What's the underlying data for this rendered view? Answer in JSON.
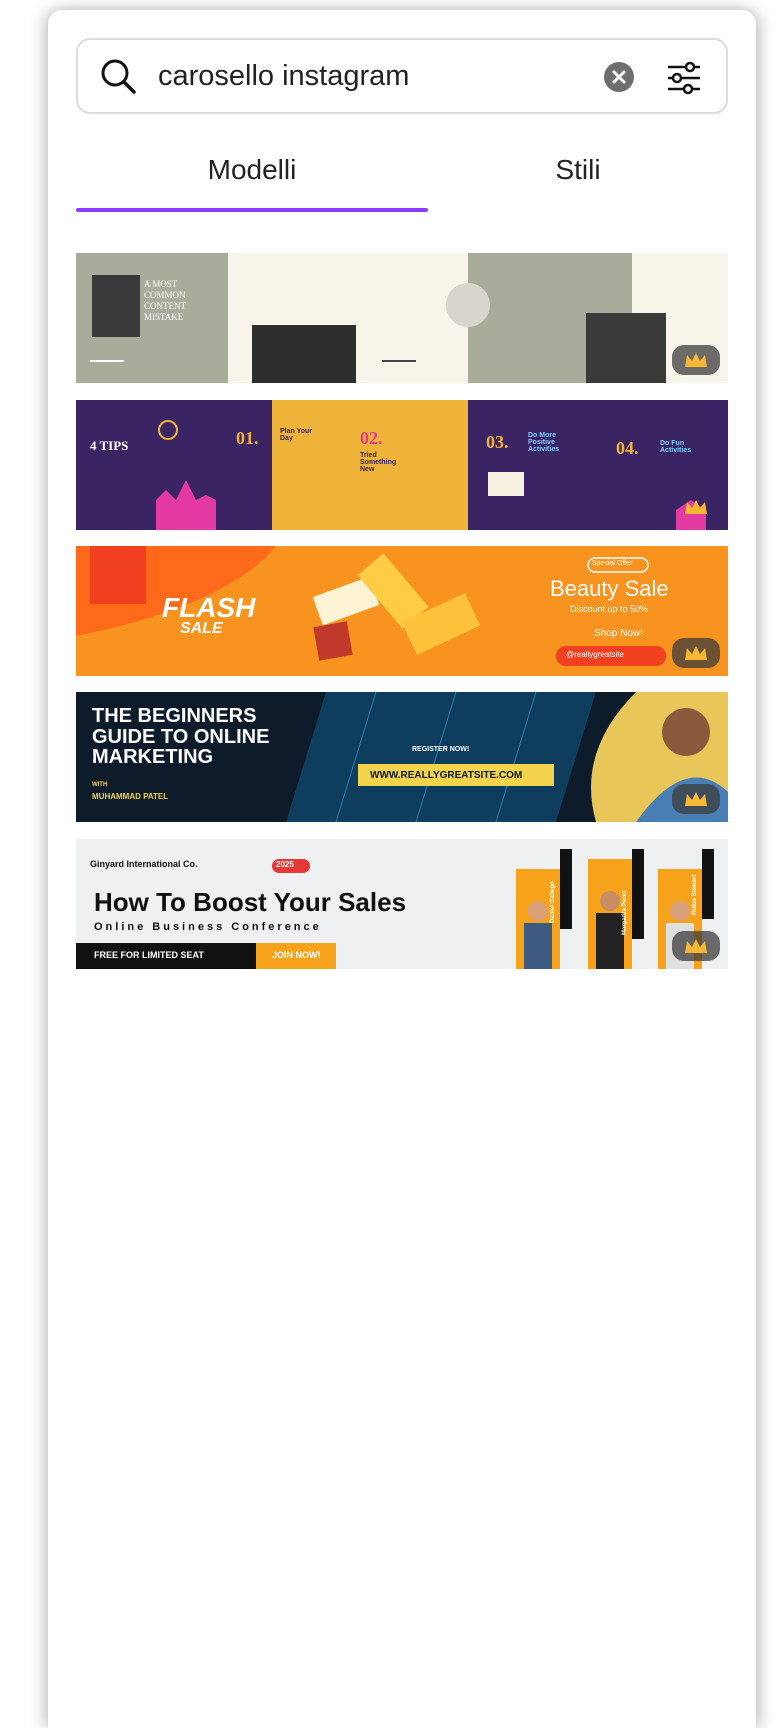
{
  "search": {
    "value": "carosello instagram",
    "placeholder": ""
  },
  "tabs": [
    {
      "label": "Modelli"
    },
    {
      "label": "Stili"
    }
  ],
  "templates": [
    {
      "lines": [
        "A MOST",
        "COMMON",
        "CONTENT",
        "MISTAKE"
      ]
    },
    {
      "title": "4 TIPS",
      "n1": "01.",
      "h1": "Plan Your Day",
      "n2": "02.",
      "h2": "Tried Something New",
      "n3": "03.",
      "h3": "Do More Positive Activities",
      "n4": "04.",
      "h4": "Do Fun Activities"
    },
    {
      "flash": "FLASH",
      "sale": "SALE",
      "offer": "Special Offer",
      "title": "Beauty Sale",
      "discount": "Discount up to 50%",
      "shop": "Shop Now!",
      "handle": "@reallygreatsite"
    },
    {
      "line1": "THE BEGINNERS",
      "line2": "GUIDE TO ONLINE",
      "line3": "MARKETING",
      "with": "WITH",
      "name": "MUHAMMAD PATEL",
      "register": "REGISTER NOW!",
      "url": "WWW.REALLYGREATSITE.COM"
    },
    {
      "company": "Ginyard International Co.",
      "badge": "2025",
      "title": "How To Boost Your Sales",
      "subtitle": "Online Business Conference",
      "free": "FREE FOR LIMITED SEAT",
      "join": "JOIN NOW!",
      "speakers": [
        "Daniel Gallego",
        "Margarita Perez",
        "Rufus Stewart"
      ]
    }
  ]
}
